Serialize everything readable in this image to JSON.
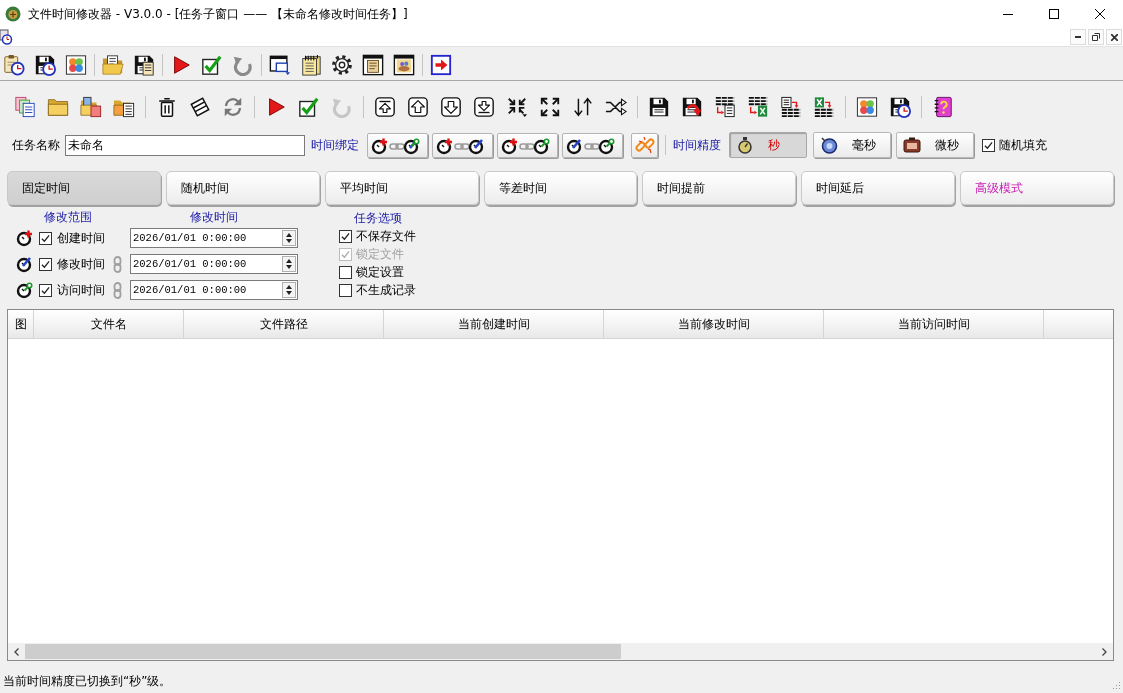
{
  "window": {
    "title": "文件时间修改器 - V3.0.0 - [任务子窗口 —— 【未命名修改时间任务】]"
  },
  "toolbars": [
    {
      "groups": [
        [
          {
            "kind": "schedule",
            "disabled": false
          },
          {
            "kind": "saveclock",
            "disabled": false
          },
          {
            "kind": "clover",
            "disabled": false
          }
        ],
        [
          {
            "kind": "openfolder",
            "disabled": false
          },
          {
            "kind": "savedoc",
            "disabled": false
          }
        ],
        [
          {
            "kind": "play",
            "disabled": false
          },
          {
            "kind": "check",
            "disabled": false
          },
          {
            "kind": "undo",
            "disabled": false
          }
        ],
        [
          {
            "kind": "window",
            "disabled": false
          },
          {
            "kind": "notes",
            "disabled": false
          },
          {
            "kind": "settings",
            "disabled": false
          },
          {
            "kind": "scroll",
            "disabled": false
          },
          {
            "kind": "picture",
            "disabled": false
          }
        ],
        [
          {
            "kind": "exit",
            "disabled": false
          }
        ]
      ]
    },
    {
      "groups": [
        [
          {
            "kind": "documents",
            "disabled": false
          },
          {
            "kind": "folder",
            "disabled": false
          },
          {
            "kind": "folders",
            "disabled": false
          },
          {
            "kind": "folderdoc",
            "disabled": false
          }
        ],
        [
          {
            "kind": "trash",
            "disabled": false
          },
          {
            "kind": "eraser",
            "disabled": false
          },
          {
            "kind": "refresh",
            "disabled": false
          }
        ],
        [
          {
            "kind": "play",
            "disabled": false
          },
          {
            "kind": "check",
            "disabled": false
          },
          {
            "kind": "undo",
            "disabled": true
          }
        ],
        [
          {
            "kind": "top",
            "disabled": false
          },
          {
            "kind": "up",
            "disabled": false
          },
          {
            "kind": "down",
            "disabled": false
          },
          {
            "kind": "bottom",
            "disabled": false
          },
          {
            "kind": "collapse",
            "disabled": false
          },
          {
            "kind": "expand",
            "disabled": false
          },
          {
            "kind": "sort",
            "disabled": false
          },
          {
            "kind": "shuffle",
            "disabled": false
          }
        ],
        [
          {
            "kind": "save",
            "disabled": false
          },
          {
            "kind": "saveas",
            "disabled": false
          },
          {
            "kind": "tabledoc",
            "disabled": false
          },
          {
            "kind": "tablexls",
            "disabled": false
          },
          {
            "kind": "doctable",
            "disabled": false
          },
          {
            "kind": "xlstable",
            "disabled": false
          }
        ],
        [
          {
            "kind": "clover",
            "disabled": false
          },
          {
            "kind": "saveclock",
            "disabled": false
          }
        ],
        [
          {
            "kind": "help",
            "disabled": false
          }
        ]
      ]
    }
  ],
  "task_name": {
    "label": "任务名称",
    "value": "未命名"
  },
  "time_binding": {
    "label": "时间绑定"
  },
  "precision": {
    "label": "时间精度",
    "options": [
      {
        "kind": "seconds",
        "label": "秒",
        "selected": true
      },
      {
        "kind": "milliseconds",
        "label": "毫秒",
        "selected": false
      },
      {
        "kind": "microseconds",
        "label": "微秒",
        "selected": false
      }
    ]
  },
  "random_fill": {
    "label": "随机填充",
    "checked": true
  },
  "mode_tabs": [
    {
      "kind": "basic",
      "label": "固定时间",
      "selected": true
    },
    {
      "kind": "basic",
      "label": "随机时间",
      "selected": false
    },
    {
      "kind": "basic",
      "label": "平均时间",
      "selected": false
    },
    {
      "kind": "basic",
      "label": "等差时间",
      "selected": false
    },
    {
      "kind": "basic",
      "label": "时间提前",
      "selected": false
    },
    {
      "kind": "basic",
      "label": "时间延后",
      "selected": false
    },
    {
      "kind": "advanced",
      "label": "高级模式",
      "selected": false
    }
  ],
  "modify_scope": {
    "heading": "修改范围",
    "time_heading": "修改时间",
    "rows": [
      {
        "kind": "create",
        "label": "创建时间",
        "checked": true,
        "linked": false,
        "value": "2026/01/01 0:00:00"
      },
      {
        "kind": "modify",
        "label": "修改时间",
        "checked": true,
        "linked": true,
        "value": "2026/01/01 0:00:00"
      },
      {
        "kind": "access",
        "label": "访问时间",
        "checked": true,
        "linked": true,
        "value": "2026/01/01 0:00:00"
      }
    ]
  },
  "task_options": {
    "heading": "任务选项",
    "items": [
      {
        "label": "不保存文件",
        "checked": true,
        "disabled": false
      },
      {
        "label": "锁定文件",
        "checked": true,
        "disabled": true
      },
      {
        "label": "锁定设置",
        "checked": false,
        "disabled": false
      },
      {
        "label": "不生成记录",
        "checked": false,
        "disabled": false
      }
    ]
  },
  "table": {
    "columns": [
      "图",
      "文件名",
      "文件路径",
      "当前创建时间",
      "当前修改时间",
      "当前访问时间"
    ]
  },
  "status_bar": {
    "text": "当前时间精度已切换到“秒”级。"
  }
}
